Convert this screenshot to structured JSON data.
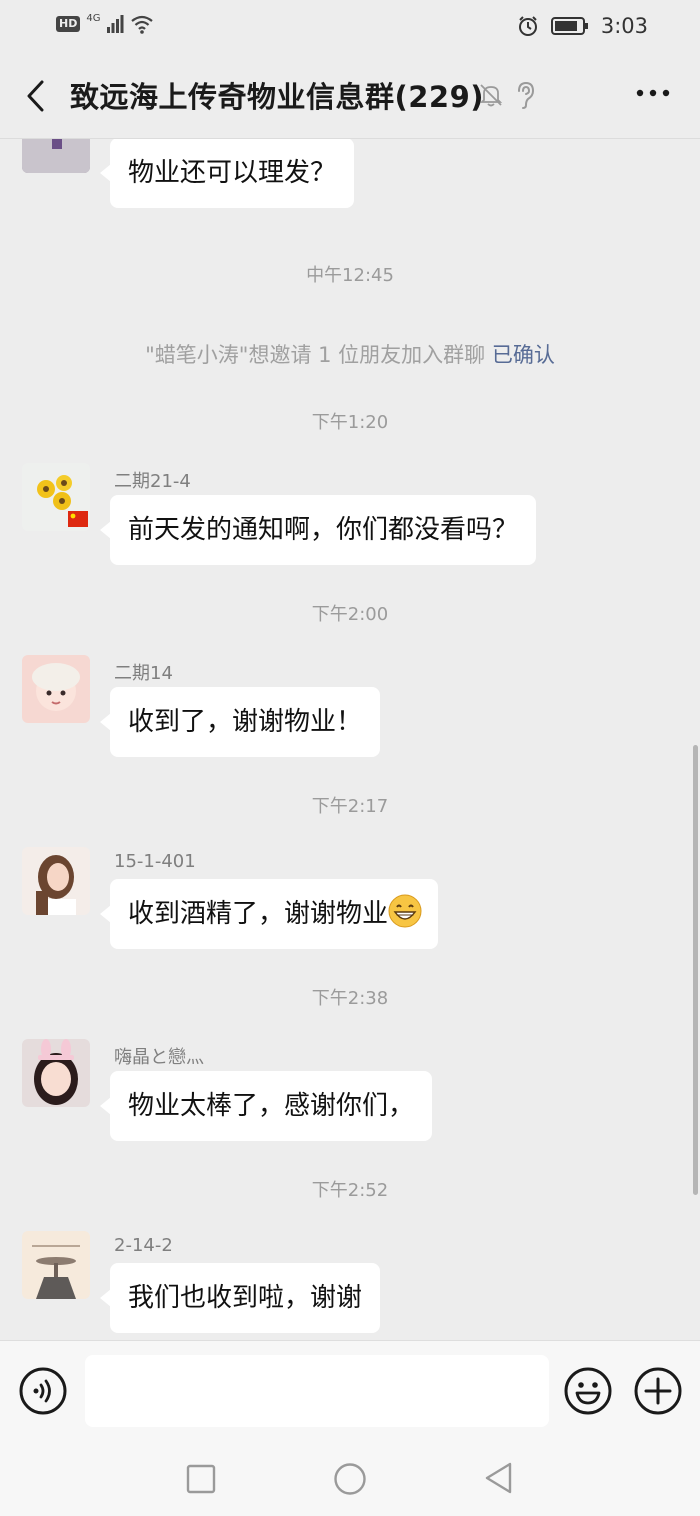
{
  "status_bar": {
    "hd": "HD",
    "network": "4G",
    "time": "3:03",
    "icons": [
      "signal-icon",
      "wifi-icon",
      "alarm-icon",
      "battery-icon"
    ]
  },
  "header": {
    "title": "致远海上传奇物业信息群(229)",
    "icons": [
      "back-icon",
      "mute-bell-icon",
      "ear-icon",
      "more-icon"
    ]
  },
  "messages": [
    {
      "type": "msg",
      "sender": "",
      "text": "物业还可以理发？"
    },
    {
      "type": "time",
      "text": "中午12:45"
    },
    {
      "type": "system",
      "text": "\"蜡笔小涛\"想邀请 1 位朋友加入群聊",
      "link": "已确认"
    },
    {
      "type": "time",
      "text": "下午1:20"
    },
    {
      "type": "msg",
      "sender": "二期21-4",
      "text": "前天发的通知啊，你们都没看吗？"
    },
    {
      "type": "time",
      "text": "下午2:00"
    },
    {
      "type": "msg",
      "sender": "二期14",
      "text": "收到了，谢谢物业！"
    },
    {
      "type": "time",
      "text": "下午2:17"
    },
    {
      "type": "msg",
      "sender": "15-1-401",
      "text": "收到酒精了，谢谢物业",
      "emoji": "grin-emoji"
    },
    {
      "type": "time",
      "text": "下午2:38"
    },
    {
      "type": "msg",
      "sender": "嗨晶と戀灬",
      "text": "物业太棒了，感谢你们，"
    },
    {
      "type": "time",
      "text": "下午2:52"
    },
    {
      "type": "msg",
      "sender": "2-14-2",
      "text": "我们也收到啦，谢谢"
    }
  ],
  "input_bar": {
    "text_value": "",
    "icons": [
      "voice-icon",
      "emoji-icon",
      "plus-icon"
    ]
  },
  "nav_bar": {
    "icons": [
      "recents-icon",
      "home-icon",
      "back-nav-icon"
    ]
  }
}
